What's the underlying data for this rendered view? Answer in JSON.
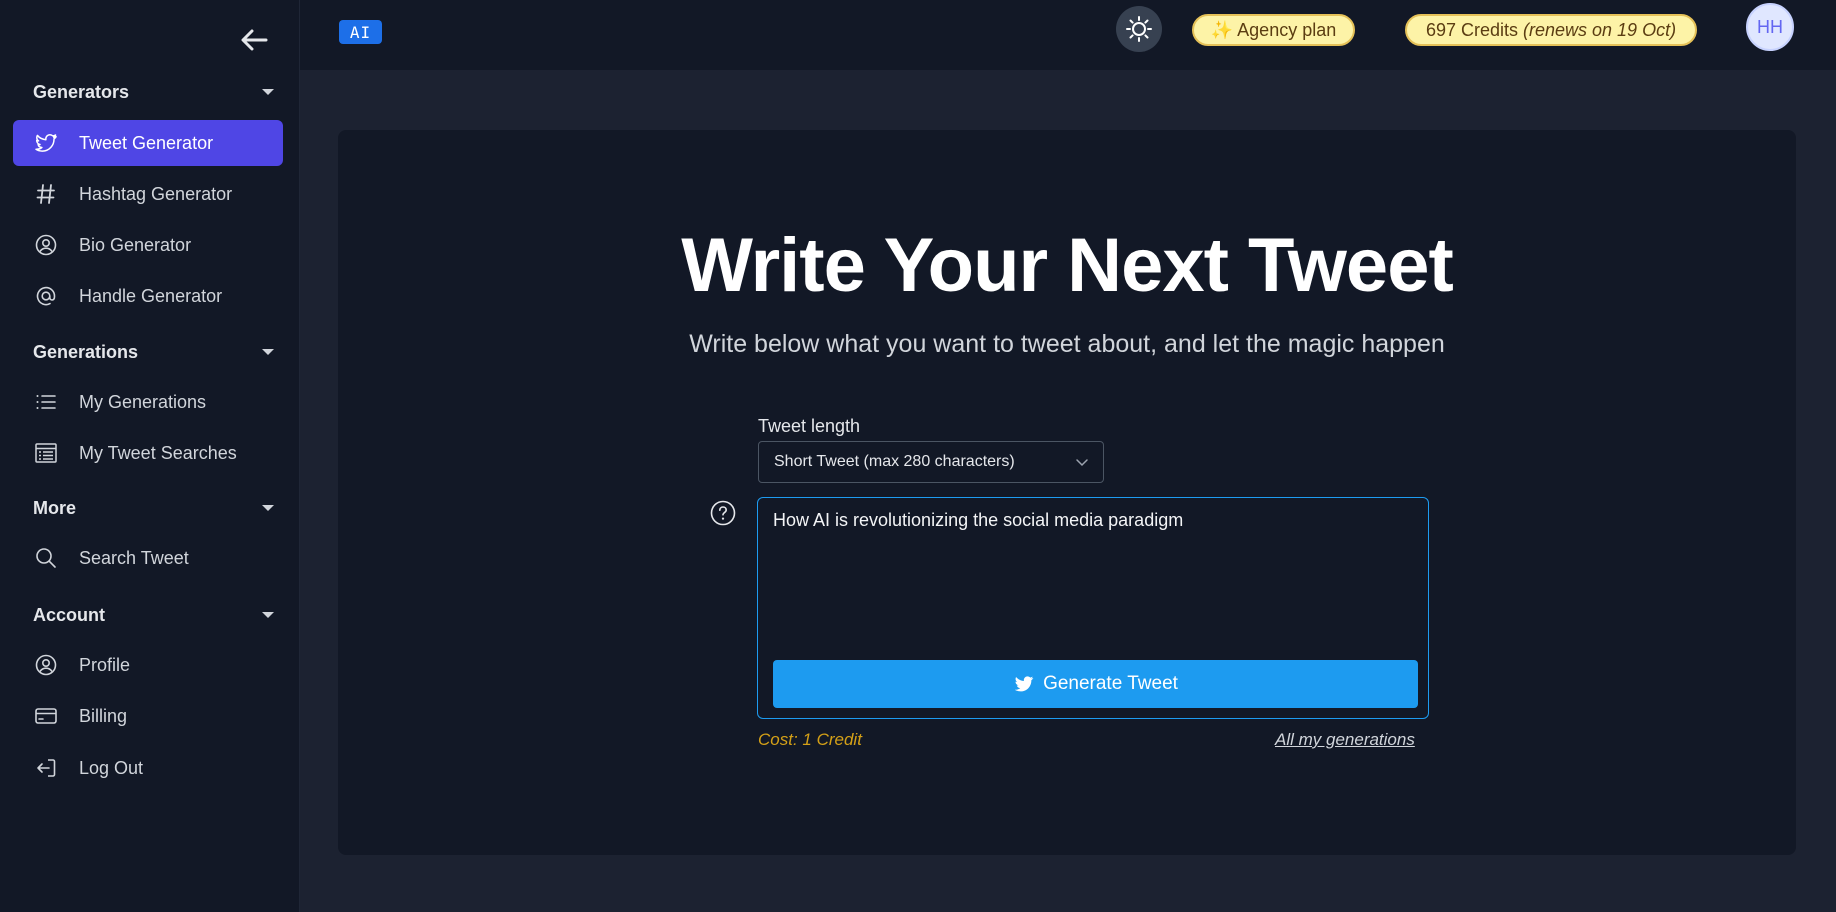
{
  "sidebar": {
    "sections": [
      {
        "title": "Generators",
        "items": [
          {
            "label": "Tweet Generator",
            "icon": "twitter-bird-icon",
            "active": true
          },
          {
            "label": "Hashtag Generator",
            "icon": "hashtag-icon"
          },
          {
            "label": "Bio Generator",
            "icon": "user-circle-icon"
          },
          {
            "label": "Handle Generator",
            "icon": "at-sign-icon"
          }
        ]
      },
      {
        "title": "Generations",
        "items": [
          {
            "label": "My Generations",
            "icon": "list-icon"
          },
          {
            "label": "My Tweet Searches",
            "icon": "table-list-icon"
          }
        ]
      },
      {
        "title": "More",
        "items": [
          {
            "label": "Search Tweet",
            "icon": "search-icon"
          }
        ]
      },
      {
        "title": "Account",
        "items": [
          {
            "label": "Profile",
            "icon": "user-circle-icon"
          },
          {
            "label": "Billing",
            "icon": "credit-card-icon"
          },
          {
            "label": "Log Out",
            "icon": "logout-icon"
          }
        ]
      }
    ]
  },
  "topbar": {
    "logo_text": "AI",
    "plan_label": "✨ Agency plan",
    "credits_label": "697 Credits",
    "credits_renew": "(renews on 19 Oct)",
    "avatar_initials": "HH"
  },
  "main": {
    "title": "Write Your Next Tweet",
    "subtitle": "Write below what you want to tweet about, and let the magic happen",
    "length_label": "Tweet length",
    "length_selected": "Short Tweet (max 280 characters)",
    "input_value": "How AI is revolutionizing the social media paradigm",
    "generate_label": "Generate Tweet",
    "cost_label": "Cost: 1 Credit",
    "all_generations_label": "All my generations"
  },
  "colors": {
    "accent": "#4f46e5",
    "twitter_blue": "#1d9bf0",
    "background": "#121826",
    "cost_text": "#d4a017"
  }
}
